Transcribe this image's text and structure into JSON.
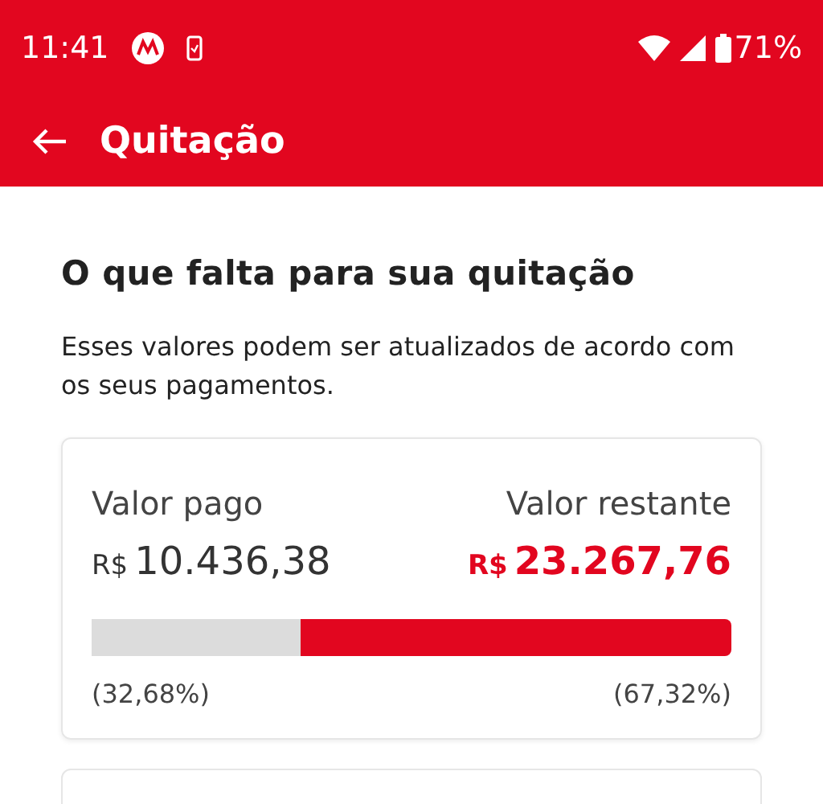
{
  "status_bar": {
    "time": "11:41",
    "battery": "71%"
  },
  "header": {
    "title": "Quitação"
  },
  "heading": "O que falta para sua quitação",
  "description": "Esses valores podem ser atualizados de acordo com os seus pagamentos.",
  "summary": {
    "paid": {
      "label": "Valor pago",
      "currency": "R$",
      "amount": "10.436,38",
      "percent": "(32,68%)"
    },
    "remaining": {
      "label": "Valor restante",
      "currency": "R$",
      "amount": "23.267,76",
      "percent": "(67,32%)"
    },
    "progress": {
      "level": 0.3268
    }
  }
}
